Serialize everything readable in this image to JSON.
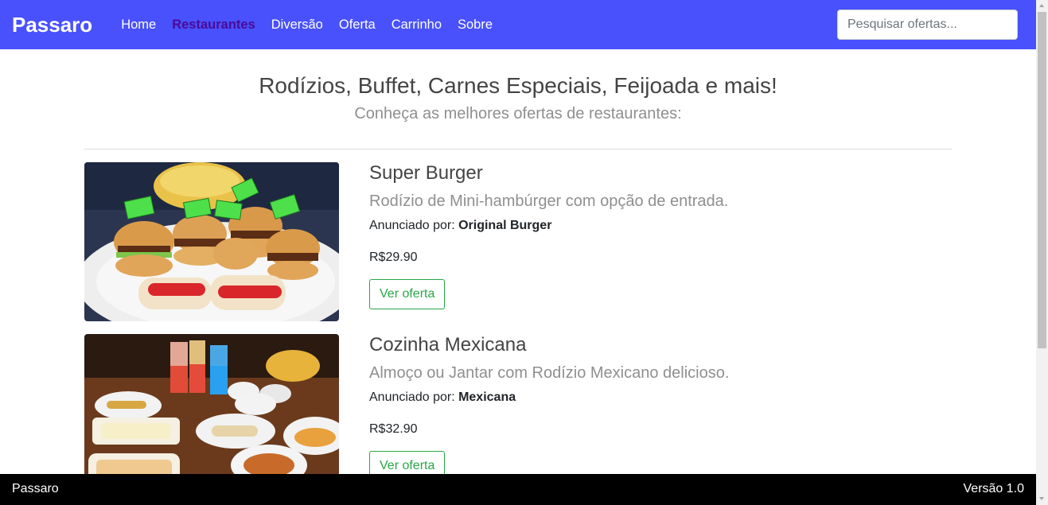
{
  "nav": {
    "brand": "Passaro",
    "links": [
      {
        "label": "Home",
        "active": false
      },
      {
        "label": "Restaurantes",
        "active": true
      },
      {
        "label": "Diversão",
        "active": false
      },
      {
        "label": "Oferta",
        "active": false
      },
      {
        "label": "Carrinho",
        "active": false
      },
      {
        "label": "Sobre",
        "active": false
      }
    ],
    "search_placeholder": "Pesquisar ofertas..."
  },
  "header": {
    "title": "Rodízios, Buffet, Carnes Especiais, Feijoada e mais!",
    "subtitle": "Conheça as melhores ofertas de restaurantes:"
  },
  "offers": [
    {
      "title": "Super Burger",
      "description": "Rodízio de Mini-hambúrger com opção de entrada.",
      "advertiser_prefix": "Anunciado por: ",
      "advertiser": "Original Burger",
      "price": "R$29.90",
      "button": "Ver oferta",
      "flag_text": "ORIGINAL BURGER"
    },
    {
      "title": "Cozinha Mexicana",
      "description": "Almoço ou Jantar com Rodízio Mexicano delicioso.",
      "advertiser_prefix": "Anunciado por: ",
      "advertiser": "Mexicana",
      "price": "R$32.90",
      "button": "Ver oferta"
    }
  ],
  "footer": {
    "left": "Passaro",
    "right": "Versão 1.0"
  },
  "colors": {
    "navbar": "#4851fb",
    "active_link": "#4b0a99",
    "button_green": "#28a745",
    "footer": "#000000"
  }
}
